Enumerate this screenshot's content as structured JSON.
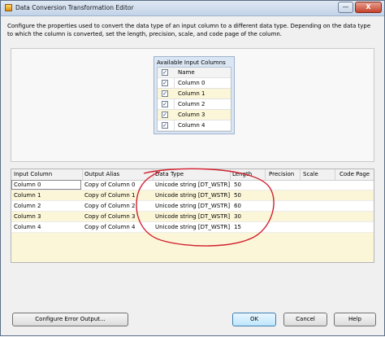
{
  "window": {
    "title": "Data Conversion Transformation Editor",
    "minimize_label": "—",
    "close_label": "X"
  },
  "description": "Configure the properties used to convert the data type of an input column to a different data type. Depending on the data type to which the column is converted, set the length, precision, scale, and code page of the column.",
  "available_input_columns": {
    "title": "Available Input Columns",
    "header": "Name",
    "items": [
      {
        "label": "Column 0",
        "checked": true
      },
      {
        "label": "Column 1",
        "checked": true
      },
      {
        "label": "Column 2",
        "checked": true
      },
      {
        "label": "Column 3",
        "checked": true
      },
      {
        "label": "Column 4",
        "checked": true
      }
    ]
  },
  "grid": {
    "columns": [
      "Input Column",
      "Output Alias",
      "Data Type",
      "Length",
      "Precision",
      "Scale",
      "Code Page"
    ],
    "rows": [
      {
        "input": "Column 0",
        "alias": "Copy of Column 0",
        "type": "Unicode string [DT_WSTR]",
        "length": "50"
      },
      {
        "input": "Column 1",
        "alias": "Copy of Column 1",
        "type": "Unicode string [DT_WSTR]",
        "length": "50"
      },
      {
        "input": "Column 2",
        "alias": "Copy of Column 2",
        "type": "Unicode string [DT_WSTR]",
        "length": "60"
      },
      {
        "input": "Column 3",
        "alias": "Copy of Column 3",
        "type": "Unicode string [DT_WSTR]",
        "length": "30"
      },
      {
        "input": "Column 4",
        "alias": "Copy of Column 4",
        "type": "Unicode string [DT_WSTR]",
        "length": "15"
      }
    ]
  },
  "buttons": {
    "configure_error_output": "Configure Error Output...",
    "ok": "OK",
    "cancel": "Cancel",
    "help": "Help"
  },
  "colors": {
    "annotation": "#d2202f",
    "row_highlight": "#fbf6d8"
  },
  "check_glyph": "✓"
}
